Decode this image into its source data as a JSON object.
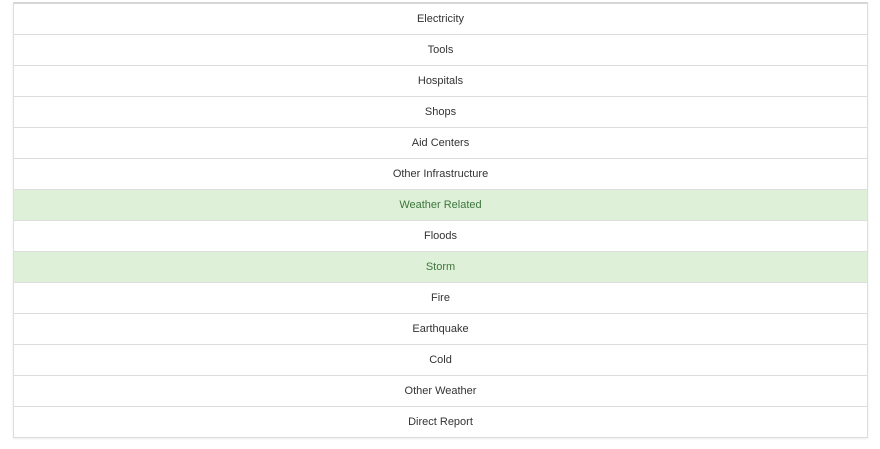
{
  "list": {
    "items": [
      {
        "label": "Electricity",
        "active": false
      },
      {
        "label": "Tools",
        "active": false
      },
      {
        "label": "Hospitals",
        "active": false
      },
      {
        "label": "Shops",
        "active": false
      },
      {
        "label": "Aid Centers",
        "active": false
      },
      {
        "label": "Other Infrastructure",
        "active": false
      },
      {
        "label": "Weather Related",
        "active": true
      },
      {
        "label": "Floods",
        "active": false
      },
      {
        "label": "Storm",
        "active": true
      },
      {
        "label": "Fire",
        "active": false
      },
      {
        "label": "Earthquake",
        "active": false
      },
      {
        "label": "Cold",
        "active": false
      },
      {
        "label": "Other Weather",
        "active": false
      },
      {
        "label": "Direct Report",
        "active": false
      }
    ]
  },
  "colors": {
    "active_bg": "#dff0d8",
    "active_text": "#3c763d",
    "text": "#333333",
    "border": "#dddddd"
  }
}
